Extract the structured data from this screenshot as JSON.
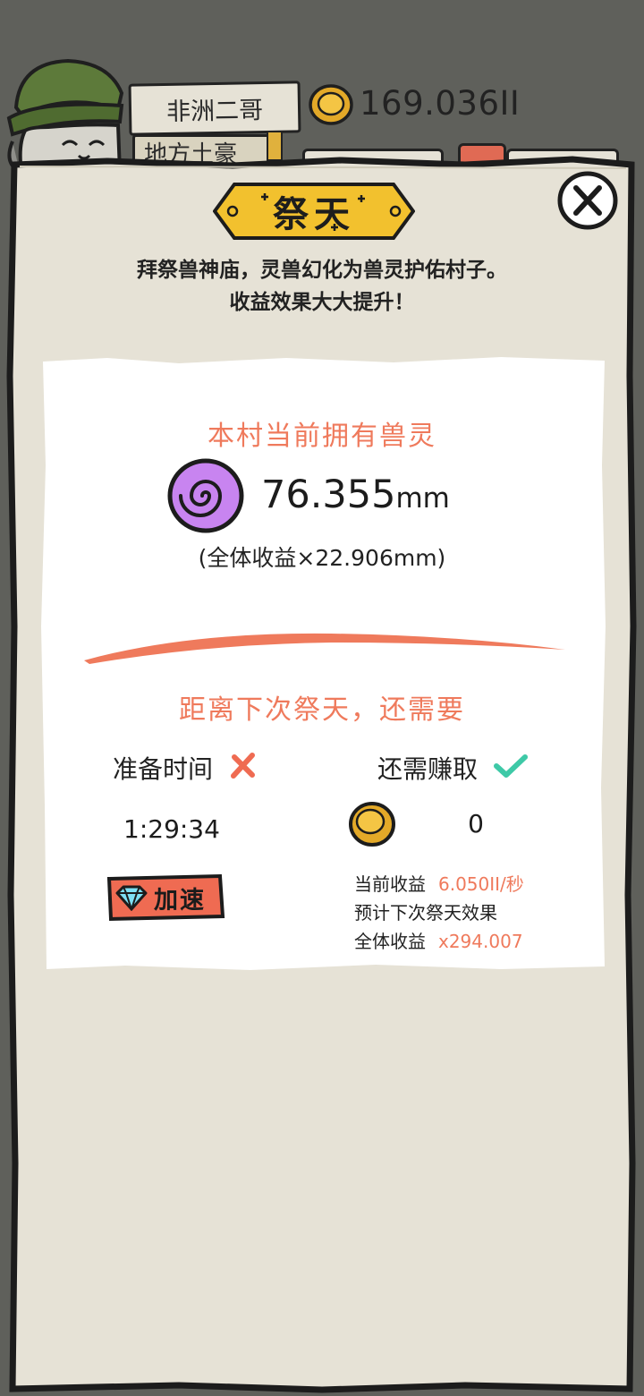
{
  "player": {
    "name": "非洲二哥",
    "rank": "地方土豪",
    "gold": "169.036II"
  },
  "dialog": {
    "title": "祭天",
    "description_line1": "拜祭兽神庙，灵兽幻化为兽灵护佑村子。",
    "description_line2": "收益效果大大提升！",
    "owned_heading": "本村当前拥有兽灵",
    "spirit_value": "76.355",
    "spirit_unit": "mm",
    "bonus_text": "(全体收益×22.906mm)",
    "next_heading": "距离下次祭天，还需要",
    "prep_label": "准备时间",
    "prep_status": "not-met",
    "earn_label": "还需赚取",
    "earn_status": "met",
    "timer": "1:29:34",
    "earn_needed": "0",
    "speed_button": "加速",
    "current_income_label": "当前收益",
    "current_income_value": "6.050II/秒",
    "forecast_label": "预计下次祭天效果",
    "total_income_label": "全体收益",
    "total_income_value": "x294.007"
  },
  "colors": {
    "accent": "#ef7a5c",
    "banner": "#f2c12e",
    "panel": "#e6e2d6",
    "check": "#3ec9a7",
    "spirit": "#c884f0"
  },
  "icons": [
    "avatar",
    "gold-coin-icon",
    "close-icon",
    "spirit-orb-icon",
    "cross-icon",
    "check-icon",
    "diamond-icon"
  ]
}
